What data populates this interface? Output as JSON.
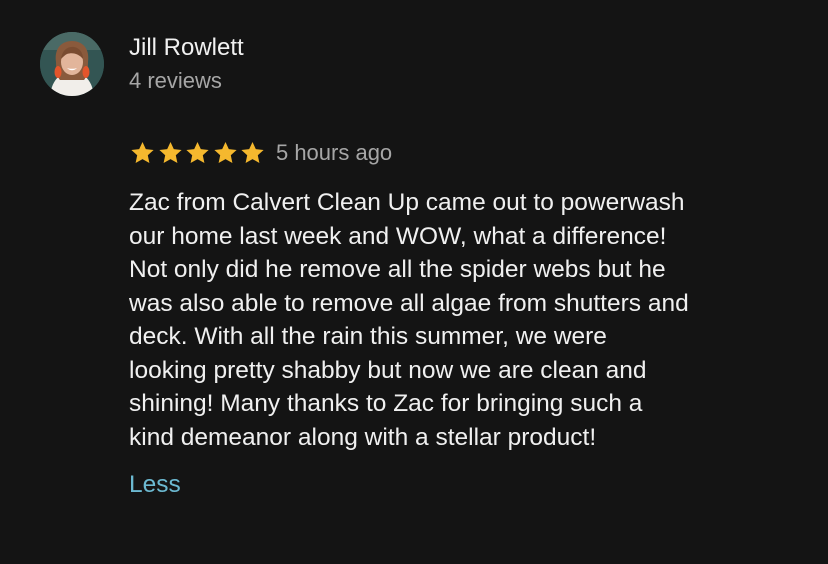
{
  "reviewer": {
    "name": "Jill Rowlett",
    "review_count": "4 reviews"
  },
  "rating": {
    "stars": 5,
    "max_stars": 5,
    "time_ago": "5 hours ago",
    "star_icon": "star-filled",
    "star_color": "#f5b82e"
  },
  "review": {
    "lines": [
      "Zac from Calvert Clean Up came out to powerwash",
      "our home last week and WOW, what a difference!",
      "Not only did he remove all the spider webs but he",
      "was also able to remove all algae from shutters and",
      "deck. With all the rain this summer, we were",
      "looking pretty shabby but now we are clean and",
      "shining! Many thanks to Zac for bringing such a",
      "kind demeanor along with a stellar product!"
    ],
    "less_label": "Less"
  },
  "colors": {
    "background": "#141414",
    "link": "#6cb9d1"
  }
}
